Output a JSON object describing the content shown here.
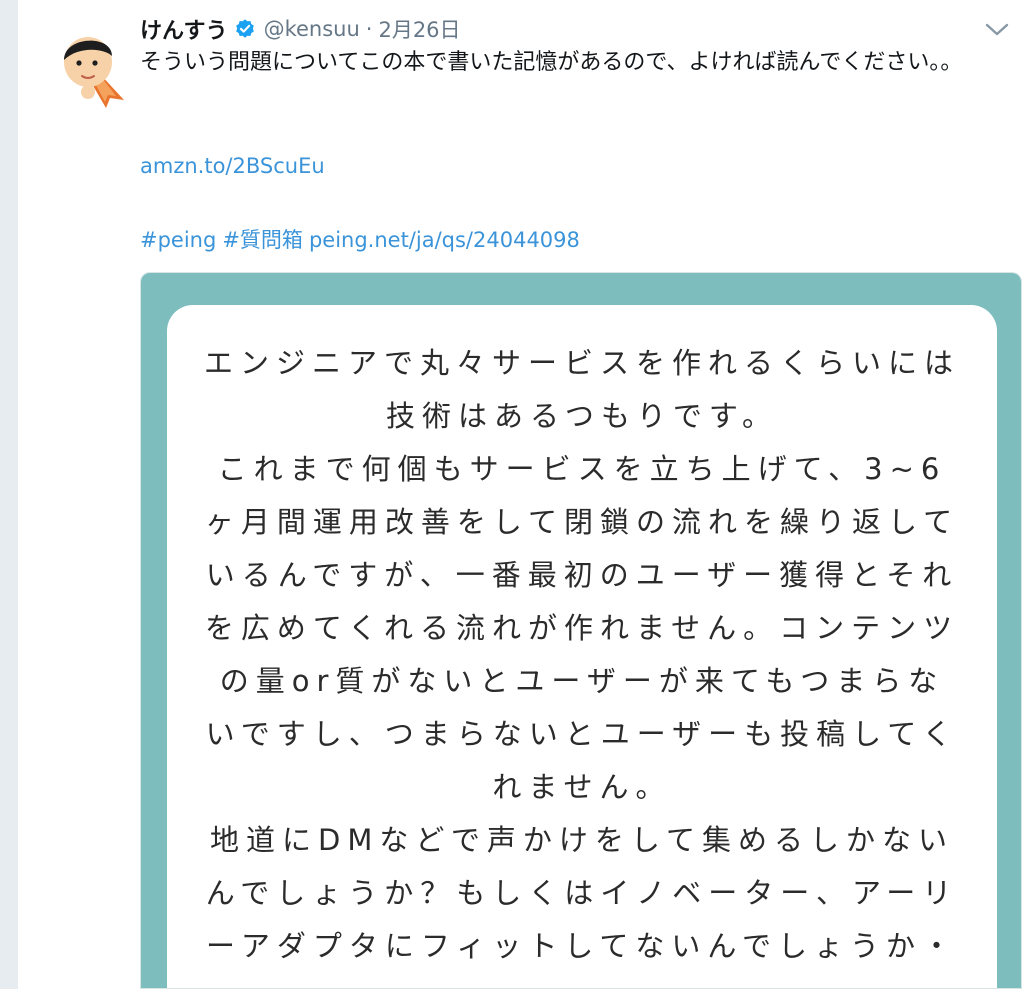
{
  "tweet": {
    "display_name": "けんすう",
    "handle": "@kensuu",
    "separator": "·",
    "date": "2月26日",
    "text": "そういう問題についてこの本で書いた記憶があるので、よければ読んでください。。",
    "link_amzn": "amzn.to/2BScuEu",
    "hashtag_1": "#peing",
    "hashtag_2": "#質問箱",
    "link_peing": "peing.net/ja/qs/24044098"
  },
  "card": {
    "question_lines": [
      "エンジニアで丸々サービスを作れるくらいには",
      "技術はあるつもりです。",
      "これまで何個もサービスを立ち上げて、3~6",
      "ヶ月間運用改善をして閉鎖の流れを繰り返して",
      "いるんですが、一番最初のユーザー獲得とそれ",
      "を広めてくれる流れが作れません。コンテンツ",
      "の量or質がないとユーザーが来てもつまらな",
      "いですし、つまらないとユーザーも投稿してく",
      "れません。",
      "地道にDMなどで声かけをして集めるしかない",
      "んでしょうか？もしくはイノベーター、アーリ",
      "ーアダプタにフィットしてないんでしょうか・",
      "・・"
    ]
  },
  "colors": {
    "link": "#3b94d9",
    "card_bg": "#7ebdbd",
    "verified": "#1da1f2",
    "muted": "#657786"
  },
  "icons": {
    "verified": "verified-badge-icon",
    "chevron": "chevron-down-icon"
  }
}
